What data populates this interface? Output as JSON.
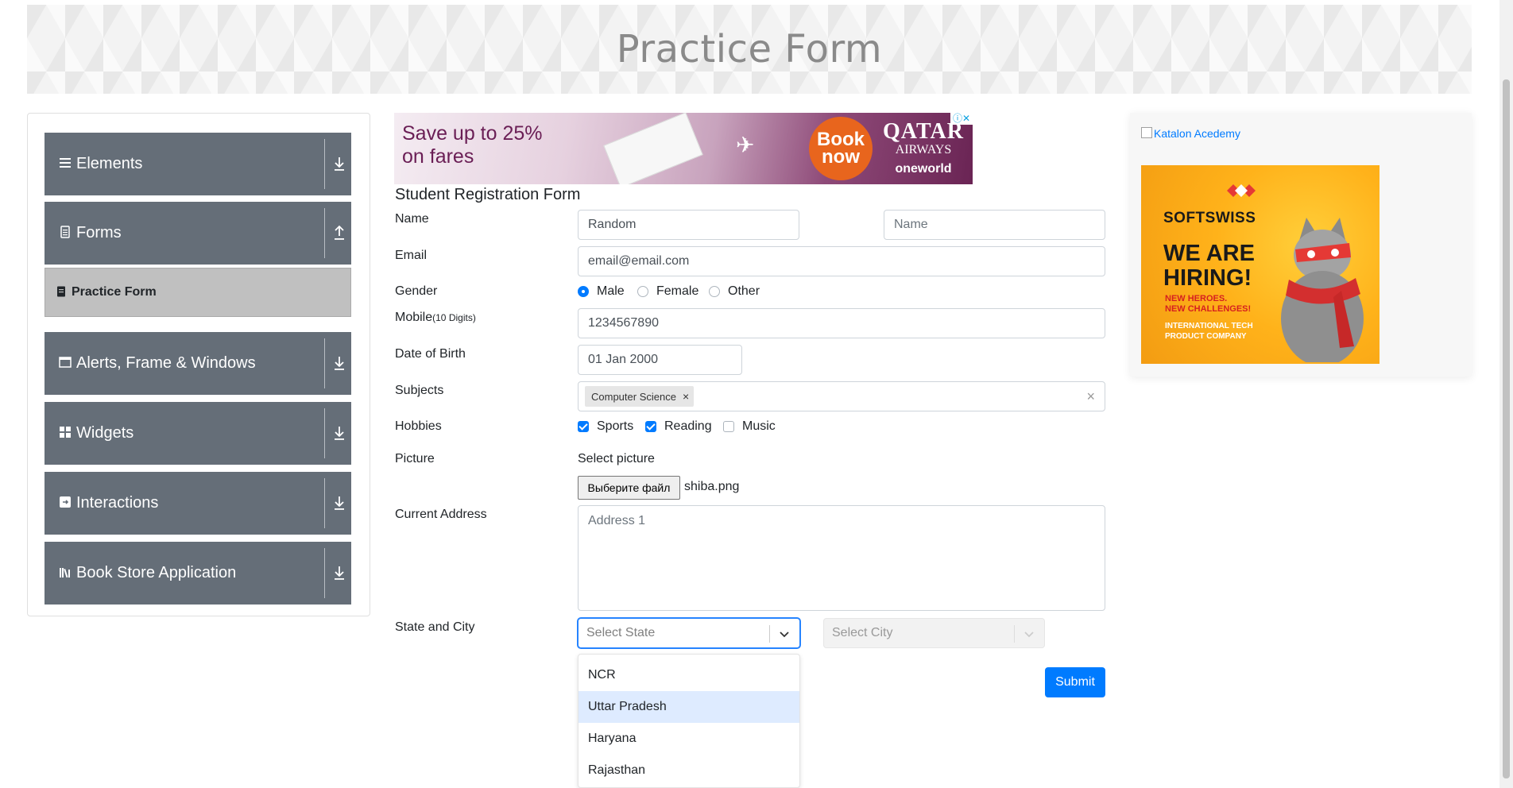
{
  "header": {
    "title": "Practice Form"
  },
  "sidebar": {
    "groups": [
      {
        "label": "Elements",
        "icon": "hamburger-icon",
        "arrow": "download-arrow-icon"
      },
      {
        "label": "Forms",
        "icon": "document-icon",
        "arrow": "upload-arrow-icon"
      },
      {
        "label": "Alerts, Frame & Windows",
        "icon": "window-icon",
        "arrow": "download-arrow-icon"
      },
      {
        "label": "Widgets",
        "icon": "widgets-icon",
        "arrow": "download-arrow-icon"
      },
      {
        "label": "Interactions",
        "icon": "interactions-icon",
        "arrow": "download-arrow-icon"
      },
      {
        "label": "Book Store Application",
        "icon": "books-icon",
        "arrow": "download-arrow-icon"
      }
    ],
    "active_sub": {
      "label": "Practice Form",
      "icon": "form-doc-icon"
    }
  },
  "ad_top": {
    "headline_line1": "Save up to 25%",
    "headline_line2": "on fares",
    "button_line1": "Book",
    "button_line2": "now",
    "brand": "QATAR",
    "brand_sub": "AIRWAYS",
    "alliance": "oneworld",
    "adchoice": "ⓘ✕"
  },
  "form": {
    "title": "Student Registration Form",
    "labels": {
      "name": "Name",
      "email": "Email",
      "gender": "Gender",
      "mobile": "Mobile",
      "mobile_hint": "(10 Digits)",
      "dob": "Date of Birth",
      "subjects": "Subjects",
      "hobbies": "Hobbies",
      "picture": "Picture",
      "address": "Current Address",
      "state_city": "State and City"
    },
    "first_name": "Random",
    "last_name_placeholder": "Name",
    "email": "email@email.com",
    "gender_options": [
      {
        "label": "Male",
        "checked": true
      },
      {
        "label": "Female",
        "checked": false
      },
      {
        "label": "Other",
        "checked": false
      }
    ],
    "mobile": "1234567890",
    "dob": "01 Jan 2000",
    "subjects": [
      "Computer Science"
    ],
    "chip_remove": "×",
    "subjects_clear": "×",
    "hobbies": [
      {
        "label": "Sports",
        "checked": true
      },
      {
        "label": "Reading",
        "checked": true
      },
      {
        "label": "Music",
        "checked": false
      }
    ],
    "picture_hint": "Select picture",
    "file_button": "Выберите файл",
    "file_name": "shiba.png",
    "address_placeholder": "Address 1",
    "state_placeholder": "Select State",
    "city_placeholder": "Select City",
    "state_options": [
      "NCR",
      "Uttar Pradesh",
      "Haryana",
      "Rajasthan"
    ],
    "highlighted_state": "Uttar Pradesh",
    "submit": "Submit"
  },
  "right_ad": {
    "image_alt": "Katalon Acedemy",
    "brand": "SOFTSWISS",
    "headline_line1": "WE ARE",
    "headline_line2": "HIRING!",
    "sub_line1": "NEW HEROES.",
    "sub_line2": "NEW CHALLENGES!",
    "tag_line1": "INTERNATIONAL TECH",
    "tag_line2": "PRODUCT COMPANY"
  },
  "colors": {
    "sidebar_group": "#656e78",
    "sidebar_active": "#c0c0c0",
    "primary": "#007bff",
    "highlight_option": "#deebff"
  }
}
